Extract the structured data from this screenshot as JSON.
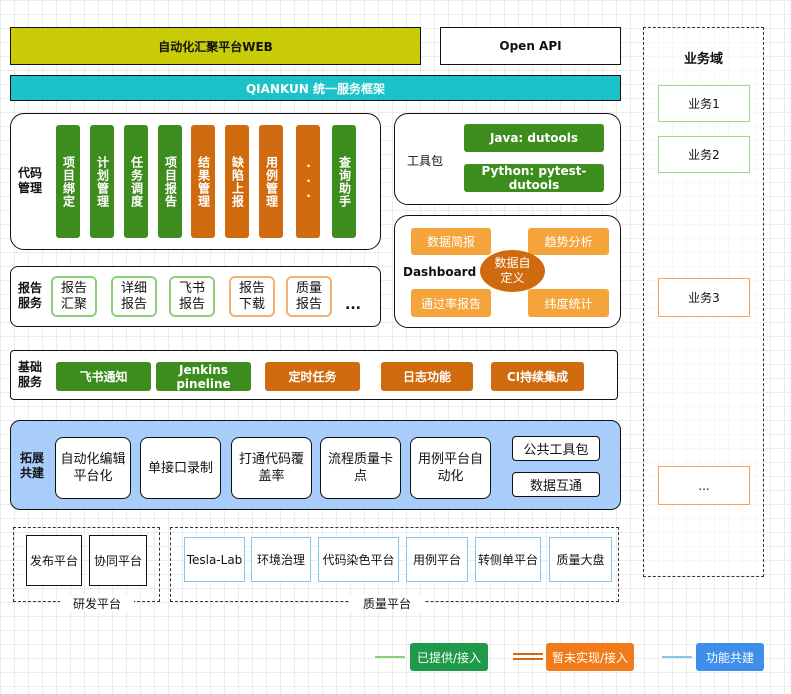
{
  "top": {
    "web": "自动化汇聚平台WEB",
    "openapi": "Open API",
    "qiankun": "QIANKUN 统一服务框架"
  },
  "code_mgmt": {
    "label": "代码管理",
    "items": [
      {
        "text": "项目绑定",
        "color": "green"
      },
      {
        "text": "计划管理",
        "color": "green"
      },
      {
        "text": "任务调度",
        "color": "green"
      },
      {
        "text": "项目报告",
        "color": "green"
      },
      {
        "text": "结果管理",
        "color": "orange"
      },
      {
        "text": "缺陷上报",
        "color": "orange"
      },
      {
        "text": "用例管理",
        "color": "orange"
      },
      {
        "text": "···",
        "color": "orange"
      },
      {
        "text": "查询助手",
        "color": "green"
      }
    ]
  },
  "toolkit": {
    "label": "工具包",
    "java": "Java: dutools",
    "python": "Python: pytest-dutools"
  },
  "dashboard": {
    "label": "Dashboard",
    "center": "数据自定义",
    "items": [
      "数据简报",
      "趋势分析",
      "通过率报告",
      "纬度统计"
    ]
  },
  "report": {
    "label": "报告服务",
    "items": [
      {
        "text": "报告汇聚",
        "color": "green"
      },
      {
        "text": "详细报告",
        "color": "green"
      },
      {
        "text": "飞书报告",
        "color": "green"
      },
      {
        "text": "报告下载",
        "color": "orange"
      },
      {
        "text": "质量报告",
        "color": "orange"
      }
    ],
    "more": "..."
  },
  "basic": {
    "label": "基础服务",
    "items": [
      {
        "text": "飞书通知",
        "color": "green"
      },
      {
        "text": "Jenkins pineline",
        "color": "green"
      },
      {
        "text": "定时任务",
        "color": "orange"
      },
      {
        "text": "日志功能",
        "color": "orange"
      },
      {
        "text": "CI持续集成",
        "color": "orange"
      }
    ]
  },
  "extend": {
    "label": "拓展共建",
    "items": [
      "自动化编辑平台化",
      "单接口录制",
      "打通代码覆盖率",
      "流程质量卡点",
      "用例平台自动化"
    ],
    "small": [
      "公共工具包",
      "数据互通"
    ]
  },
  "dev_platform": {
    "label": "研发平台",
    "items": [
      "发布平台",
      "协同平台"
    ]
  },
  "quality_platform": {
    "label": "质量平台",
    "items": [
      "Tesla-Lab",
      "环境治理",
      "代码染色平台",
      "用例平台",
      "转侧单平台",
      "质量大盘"
    ]
  },
  "business": {
    "title": "业务域",
    "items": [
      "业务1",
      "业务2",
      "业务3",
      "..."
    ]
  },
  "legend": [
    "已提供/接入",
    "暂未实现/接入",
    "功能共建"
  ],
  "colors": {
    "green": "#3d8c1e",
    "orange": "#cf6b0e",
    "light_orange": "#f4a43b",
    "cyan": "#19c3c8",
    "olive": "#c9cc06",
    "blue_panel": "#a8cdfa",
    "legend_blue": "#3d8fea"
  }
}
